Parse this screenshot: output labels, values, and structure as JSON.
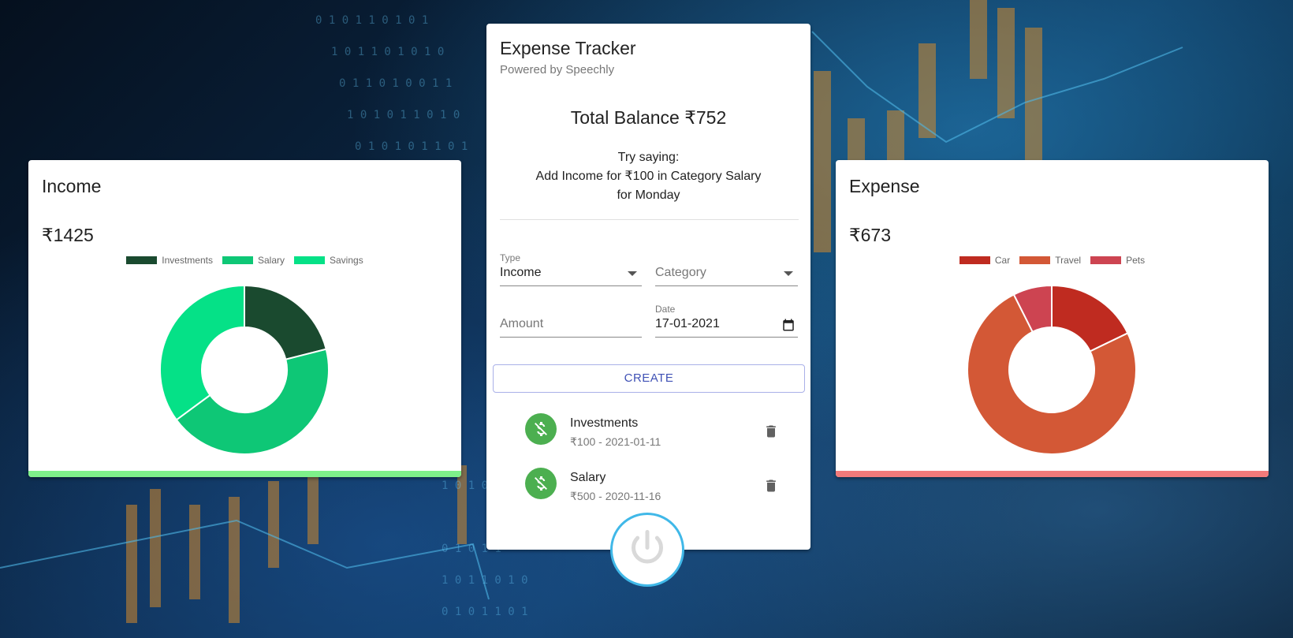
{
  "income_card": {
    "title": "Income",
    "amount": "₹1425",
    "accent": "#7ef08a",
    "legend": [
      {
        "label": "Investments",
        "color": "#1a4a2f"
      },
      {
        "label": "Salary",
        "color": "#0ec776"
      },
      {
        "label": "Savings",
        "color": "#05e187"
      }
    ],
    "chart_data": {
      "type": "pie",
      "donut": true,
      "categories": [
        "Investments",
        "Salary",
        "Savings"
      ],
      "values": [
        300,
        625,
        500
      ],
      "colors": [
        "#1a4a2f",
        "#0ec776",
        "#05e187"
      ]
    }
  },
  "expense_card": {
    "title": "Expense",
    "amount": "₹673",
    "accent": "#f27a7a",
    "legend": [
      {
        "label": "Car",
        "color": "#bf2b20"
      },
      {
        "label": "Travel",
        "color": "#d35836"
      },
      {
        "label": "Pets",
        "color": "#cd4451"
      }
    ],
    "chart_data": {
      "type": "pie",
      "donut": true,
      "categories": [
        "Car",
        "Travel",
        "Pets"
      ],
      "values": [
        120,
        503,
        50
      ],
      "colors": [
        "#bf2b20",
        "#d35836",
        "#cd4451"
      ]
    }
  },
  "main_card": {
    "title": "Expense Tracker",
    "subtitle": "Powered by Speechly",
    "balance": "Total Balance ₹752",
    "hint_line1": "Try saying:",
    "hint_line2": "Add Income for ₹100 in Category Salary",
    "hint_line3": "for Monday",
    "form": {
      "type_label": "Type",
      "type_value": "Income",
      "category_placeholder": "Category",
      "amount_placeholder": "Amount",
      "date_label": "Date",
      "date_value": "17-01-2021",
      "create_label": "CREATE"
    },
    "transactions": [
      {
        "name": "Investments",
        "detail": "₹100 - 2021-01-11"
      },
      {
        "name": "Salary",
        "detail": "₹500 - 2020-11-16"
      }
    ]
  },
  "icons": {
    "transaction": "money-off-icon",
    "delete": "trash-icon",
    "calendar": "calendar-icon",
    "mic": "power-icon"
  }
}
